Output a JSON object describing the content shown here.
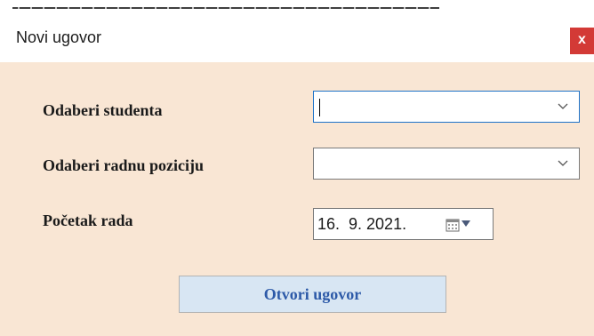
{
  "window": {
    "title": "Novi ugovor",
    "close_label": "x"
  },
  "form": {
    "student_label": "Odaberi studenta",
    "student_value": "",
    "position_label": "Odaberi radnu poziciju",
    "position_value": "",
    "start_label": "Početak rada",
    "start_date": "16.  9. 2021."
  },
  "actions": {
    "open_contract_label": "Otvori ugovor"
  },
  "colors": {
    "content_bg": "#f9e6d4",
    "close_bg": "#d33a36",
    "button_bg": "#d8e6f3",
    "button_text": "#2d5aa8",
    "focus_border": "#1e72c8"
  },
  "icons": {
    "dropdown": "chevron-down-icon",
    "calendar": "calendar-icon",
    "calendar_dropdown": "triangle-down-icon",
    "close": "close-icon"
  }
}
